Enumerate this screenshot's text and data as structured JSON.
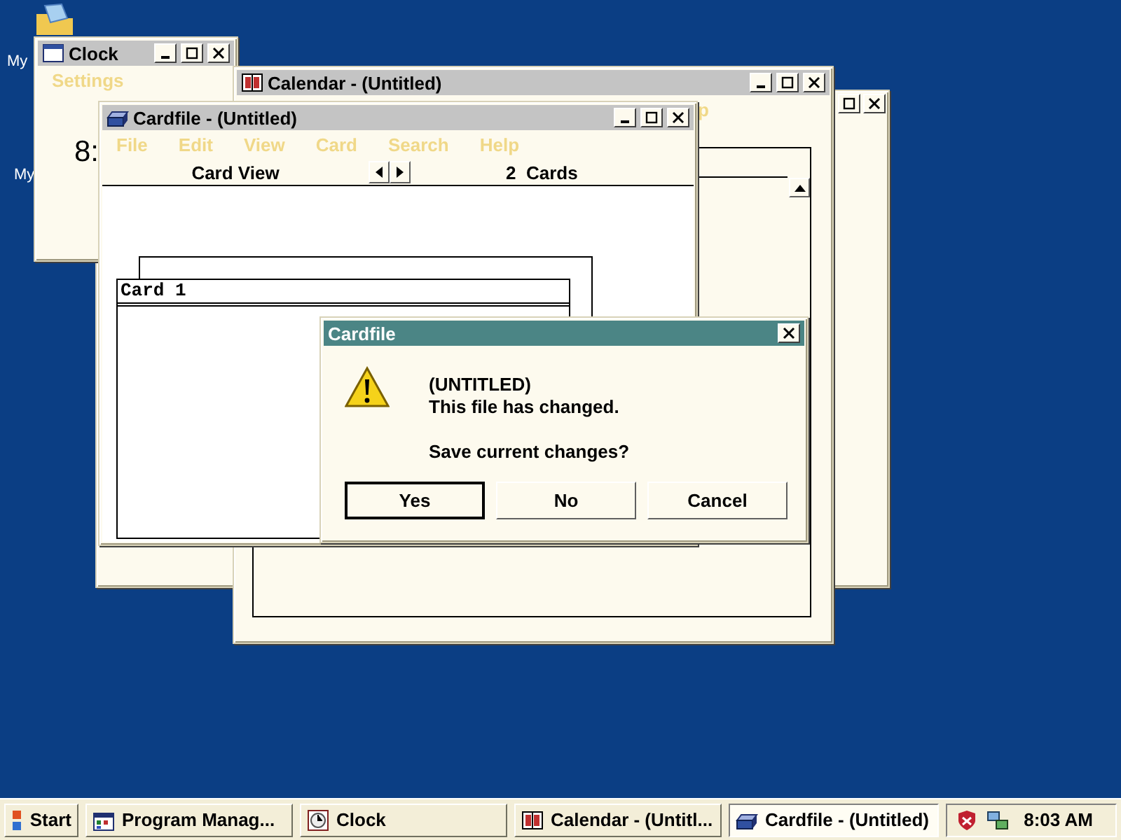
{
  "desktop_icons": [
    {
      "label": "My"
    },
    {
      "label": "My"
    }
  ],
  "clock_window": {
    "title": "Clock",
    "menu": [
      "Settings"
    ],
    "time": "8:"
  },
  "calendar_window": {
    "title": "Calendar - (Untitled)",
    "menu_fragment": "p"
  },
  "cardfile_window": {
    "title": "Cardfile - (Untitled)",
    "menu": [
      "File",
      "Edit",
      "View",
      "Card",
      "Search",
      "Help"
    ],
    "view": "Card View",
    "card_count": "2  Cards",
    "cards": [
      {
        "title": "Card 1"
      }
    ]
  },
  "dialog": {
    "title": "Cardfile",
    "lines": [
      "(UNTITLED)",
      "This file has changed."
    ],
    "question": "Save current changes?",
    "buttons": [
      {
        "label": "Yes",
        "default": true
      },
      {
        "label": "No",
        "default": false
      },
      {
        "label": "Cancel",
        "default": false
      }
    ]
  },
  "taskbar": {
    "start": "Start",
    "tasks": [
      {
        "label": "Program Manag...",
        "kind": "program-manager",
        "selected": false
      },
      {
        "label": "Clock",
        "kind": "clock",
        "selected": false
      },
      {
        "label": "Calendar - (Untitl...",
        "kind": "calendar",
        "selected": false
      },
      {
        "label": "Cardfile - (Untitled)",
        "kind": "cardfile",
        "selected": true
      }
    ],
    "time": "8:03 AM"
  }
}
